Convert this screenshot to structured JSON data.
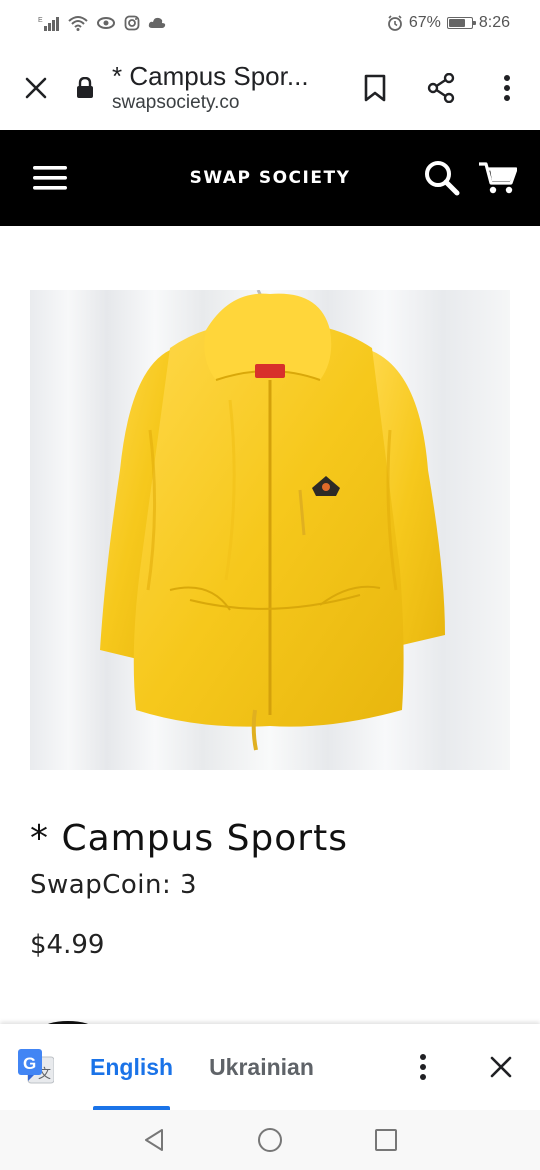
{
  "status_bar": {
    "battery_percent": "67%",
    "battery_level": 0.67,
    "time": "8:26",
    "icons": [
      "signal-icon",
      "wifi-icon",
      "eye-icon",
      "instagram-icon",
      "cloud-icon",
      "alarm-icon",
      "battery-icon"
    ]
  },
  "browser": {
    "page_title": "* Campus Spor...",
    "domain": "swapsociety.co",
    "icons": [
      "close-icon",
      "lock-icon",
      "bookmark-icon",
      "share-icon",
      "more-vert-icon"
    ]
  },
  "site_header": {
    "brand": "SWAP SOCIETY",
    "icons": [
      "hamburger-menu-icon",
      "search-icon",
      "cart-icon"
    ]
  },
  "product": {
    "image_subject": "yellow hooded jacket",
    "title": "* Campus Sports",
    "swapcoin": "SwapCoin: 3",
    "price": "$4.99"
  },
  "translate_bar": {
    "source_lang": "English",
    "target_lang": "Ukrainian",
    "icons": [
      "google-translate-icon",
      "more-vert-icon",
      "close-icon"
    ]
  },
  "colors": {
    "accent": "#1a73e8",
    "header_bg": "#000000",
    "jacket": "#f5c518"
  }
}
